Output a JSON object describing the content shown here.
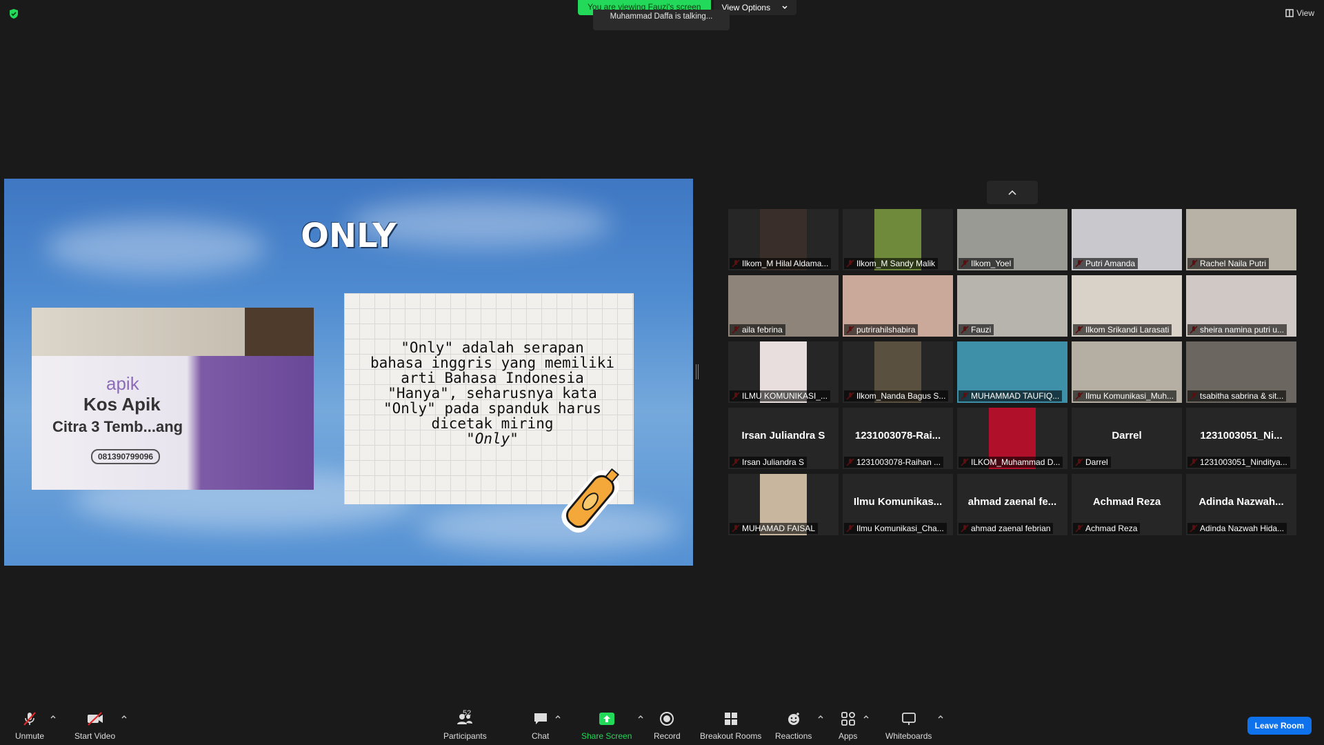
{
  "topbar": {
    "viewing_banner": "You are viewing Fauzi's screen",
    "view_options": "View Options",
    "talking": "Muhammad Daffa is talking...",
    "view_button": "View"
  },
  "slide": {
    "title": "ONLY",
    "photo_text": {
      "brand": "apik",
      "name": "Kos Apik",
      "location": "Citra 3 Temb...ang",
      "phone": "081390799096"
    },
    "body_lines": [
      "\"Only\" adalah serapan",
      "bahasa inggris yang memiliki",
      "arti Bahasa Indonesia",
      "\"Hanya\", seharusnya kata",
      "\"Only\" pada spanduk harus",
      "dicetak miring"
    ],
    "italic_line": "\"Only\""
  },
  "gallery": [
    {
      "label": "Ilkom_M Hilal Aldama...",
      "bg": "#3a2e2a",
      "video": true,
      "full": false
    },
    {
      "label": "Ilkom_M Sandy Malik",
      "bg": "#6f8a3a",
      "video": true,
      "full": false
    },
    {
      "label": "Ilkom_Yoel",
      "bg": "#9a9a95",
      "video": true,
      "full": true
    },
    {
      "label": "Putri Amanda",
      "bg": "#c9c9cd",
      "video": true,
      "full": true
    },
    {
      "label": "Rachel Naila Putri",
      "bg": "#b8b1a6",
      "video": true,
      "full": true
    },
    {
      "label": "aila febrina",
      "bg": "#8f8479",
      "video": true,
      "full": true
    },
    {
      "label": "putrirahilshabira",
      "bg": "#caa99a",
      "video": true,
      "full": true
    },
    {
      "label": "Fauzi",
      "bg": "#b7b4ae",
      "video": true,
      "full": true
    },
    {
      "label": "Ilkom Srikandi Larasati",
      "bg": "#d9d2c8",
      "video": true,
      "full": true
    },
    {
      "label": "sheira namina putri u...",
      "bg": "#cfc8c4",
      "video": true,
      "full": true
    },
    {
      "label": "ILMU KOMUNIKASI_...",
      "bg": "#e9dede",
      "video": true,
      "full": false
    },
    {
      "label": "Ilkom_Nanda Bagus S...",
      "bg": "#5a5040",
      "video": true,
      "full": false
    },
    {
      "label": "MUHAMMAD TAUFIQ...",
      "bg": "#3e8fa8",
      "video": true,
      "full": true
    },
    {
      "label": "Ilmu Komunikasi_Muh...",
      "bg": "#b5aea2",
      "video": true,
      "full": true
    },
    {
      "label": "tsabitha sabrina & sit...",
      "bg": "#6b6660",
      "video": true,
      "full": true
    },
    {
      "label": "Irsan Juliandra S",
      "name": "Irsan Juliandra S",
      "video": false
    },
    {
      "label": "1231003078-Raihan ...",
      "name": "1231003078-Rai...",
      "video": false
    },
    {
      "label": "ILKOM_Muhammad D...",
      "bg": "#b0102a",
      "video": true,
      "full": false
    },
    {
      "label": "Darrel",
      "name": "Darrel",
      "video": false
    },
    {
      "label": "1231003051_Ninditya...",
      "name": "1231003051_Ni...",
      "video": false
    },
    {
      "label": "MUHAMAD FAISAL",
      "bg": "#c8b79e",
      "video": true,
      "full": false
    },
    {
      "label": "Ilmu Komunikasi_Cha...",
      "name": "Ilmu Komunikas...",
      "video": false
    },
    {
      "label": "ahmad zaenal febrian",
      "name": "ahmad zaenal fe...",
      "video": false
    },
    {
      "label": "Achmad Reza",
      "name": "Achmad Reza",
      "video": false
    },
    {
      "label": "Adinda Nazwah Hida...",
      "name": "Adinda Nazwah...",
      "video": false
    }
  ],
  "toolbar": {
    "unmute": "Unmute",
    "start_video": "Start Video",
    "participants": "Participants",
    "participant_count": "52",
    "chat": "Chat",
    "share_screen": "Share Screen",
    "record": "Record",
    "breakout_rooms": "Breakout Rooms",
    "reactions": "Reactions",
    "apps": "Apps",
    "whiteboards": "Whiteboards",
    "leave": "Leave Room"
  },
  "colors": {
    "share_green": "#23d959",
    "leave_blue": "#0e72ed",
    "muted_red": "#e02828"
  }
}
